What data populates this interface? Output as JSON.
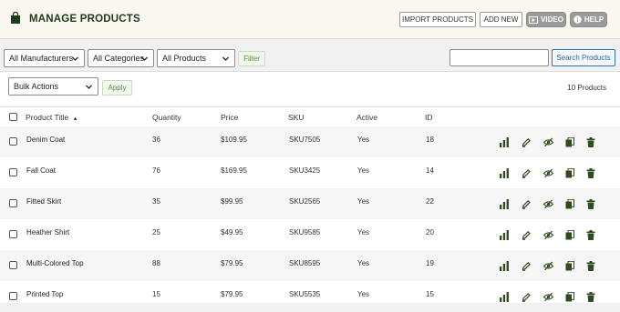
{
  "header": {
    "title": "MANAGE PRODUCTS",
    "buttons": {
      "import": "IMPORT PRODUCTS",
      "add_new": "ADD NEW",
      "video": "VIDEO",
      "help": "HELP"
    }
  },
  "filters": {
    "manufacturers": "All Manufacturers",
    "categories": "All Categories",
    "products": "All Products",
    "filter_button": "Filter",
    "search_value": "",
    "search_button": "Search Products"
  },
  "bulk": {
    "select_value": "Bulk Actions",
    "apply_button": "Apply",
    "count_text": "10 Products"
  },
  "table": {
    "columns": {
      "title": "Product Title",
      "quantity": "Quantity",
      "price": "Price",
      "sku": "SKU",
      "active": "Active",
      "id": "ID"
    },
    "sort_indicator": "▲",
    "rows": [
      {
        "title": "Denim Coat",
        "quantity": "36",
        "price": "$109.95",
        "sku": "SKU7505",
        "active": "Yes",
        "id": "18"
      },
      {
        "title": "Fall Coat",
        "quantity": "76",
        "price": "$169.95",
        "sku": "SKU3425",
        "active": "Yes",
        "id": "14"
      },
      {
        "title": "Fitted Skirt",
        "quantity": "35",
        "price": "$99.95",
        "sku": "SKU2565",
        "active": "Yes",
        "id": "22"
      },
      {
        "title": "Heather Shirt",
        "quantity": "25",
        "price": "$49.95",
        "sku": "SKU9585",
        "active": "Yes",
        "id": "20"
      },
      {
        "title": "Multi-Colored Top",
        "quantity": "88",
        "price": "$79.95",
        "sku": "SKU8595",
        "active": "Yes",
        "id": "19"
      },
      {
        "title": "Printed Top",
        "quantity": "15",
        "price": "$79.95",
        "sku": "SKU5535",
        "active": "Yes",
        "id": "15"
      }
    ]
  },
  "colors": {
    "brand": "#1e3a1e",
    "icon": "#2f4a1f",
    "link_blue": "#2a62a6",
    "green_button": "#5a8f3e"
  },
  "row_action_icons": [
    "stats-icon",
    "edit-icon",
    "hide-icon",
    "copy-icon",
    "delete-icon"
  ]
}
